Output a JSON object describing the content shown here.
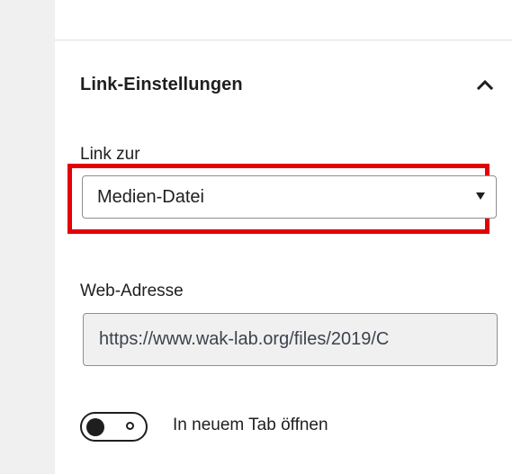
{
  "panel": {
    "section_title": "Link-Einstellungen",
    "collapse_icon": "chevron-up-icon"
  },
  "link_to": {
    "label": "Link zur",
    "selected_option": "Medien-Datei",
    "dropdown_icon": "caret-down-icon",
    "highlight_color": "#e3000b"
  },
  "web_address": {
    "label": "Web-Adresse",
    "value": "https://www.wak-lab.org/files/2019/C"
  },
  "new_tab": {
    "label": "In neuem Tab öffnen",
    "toggle_state": "off"
  }
}
